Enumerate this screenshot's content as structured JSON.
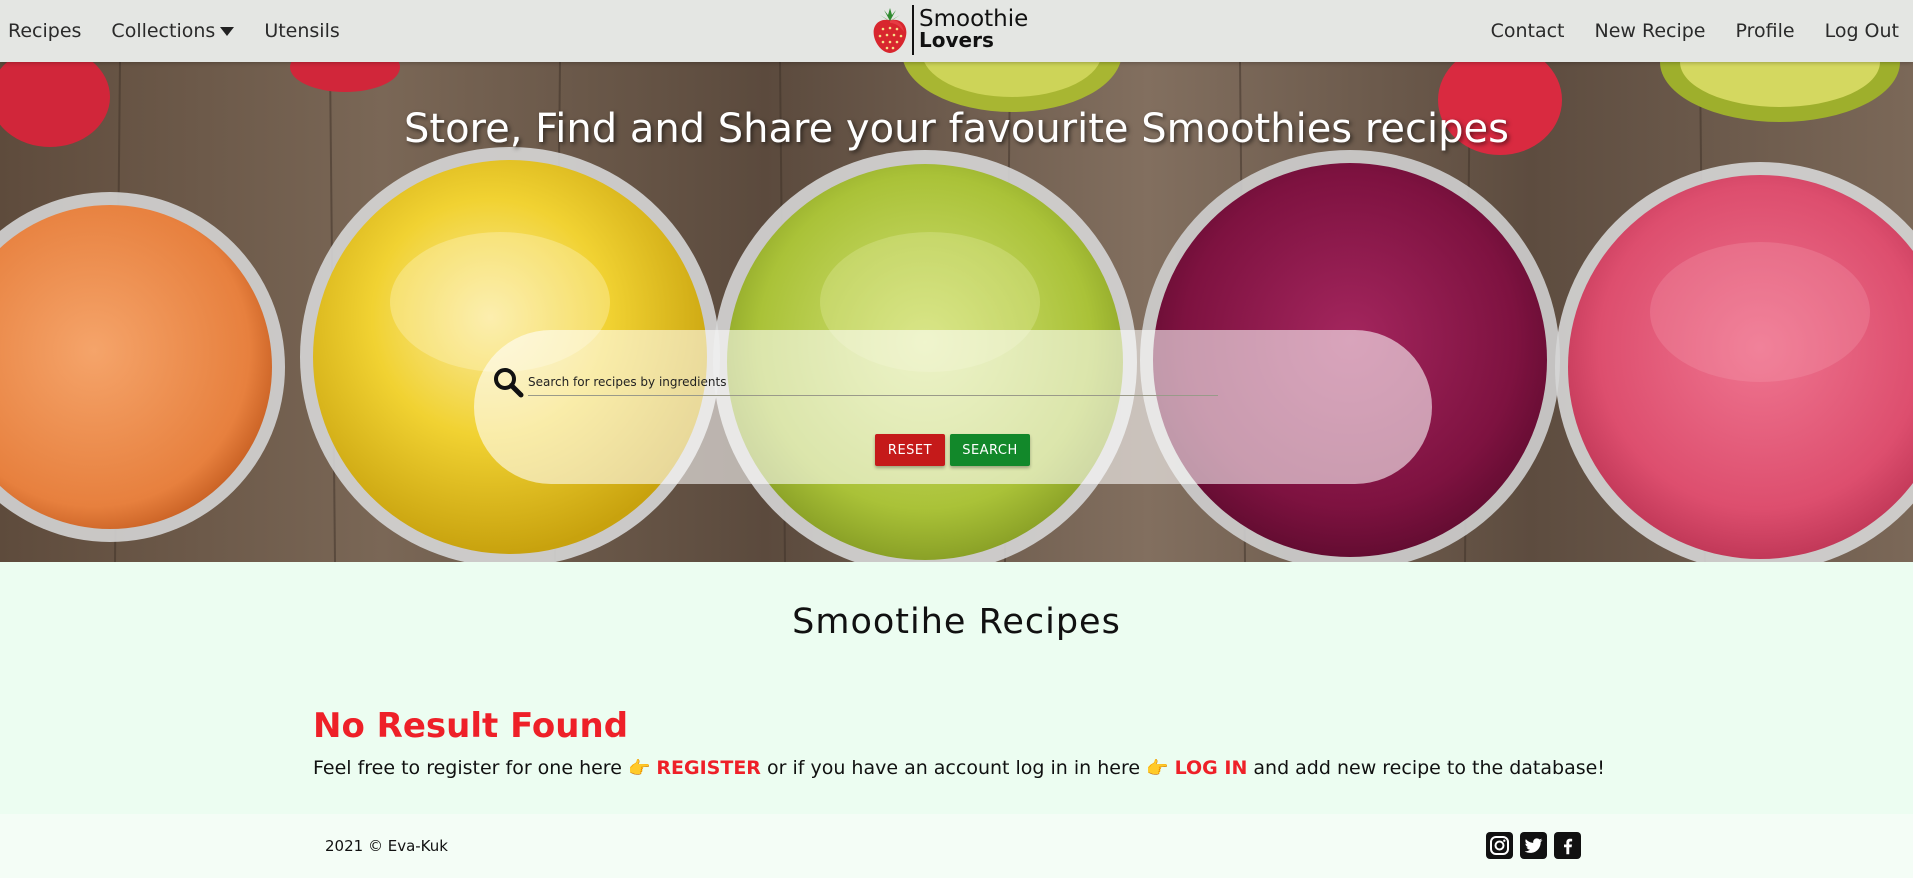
{
  "nav": {
    "left": [
      {
        "label": "Recipes"
      },
      {
        "label": "Collections"
      },
      {
        "label": "Utensils"
      }
    ],
    "right": [
      {
        "label": "Contact"
      },
      {
        "label": "New Recipe"
      },
      {
        "label": "Profile"
      },
      {
        "label": "Log Out"
      }
    ],
    "brand": {
      "line1": "Smoothie",
      "line2": "Lovers"
    }
  },
  "hero": {
    "title": "Store, Find and Share your favourite Smoothies recipes",
    "search": {
      "placeholder": "Search for recipes by ingredients",
      "value": "",
      "reset_label": "RESET",
      "search_label": "SEARCH"
    }
  },
  "main": {
    "section_title": "Smootihe Recipes",
    "no_result": "No Result Found",
    "message": {
      "part1": "Feel free to register for one here ",
      "hand1": "👉",
      "register_link": "REGISTER",
      "part2": " or if you have an account log in in here ",
      "hand2": "👉",
      "login_link": "LOG IN",
      "part3": " and add new recipe to the database!"
    }
  },
  "footer": {
    "copyright": "2021 © Eva-Kuk",
    "socials": [
      "instagram-icon",
      "twitter-icon",
      "facebook-icon"
    ]
  },
  "colors": {
    "navbar": "#e4e6e3",
    "reset": "#c51a1a",
    "search": "#12882a",
    "accent_red": "#ee2028",
    "page_bg": "#ecfdf1"
  }
}
